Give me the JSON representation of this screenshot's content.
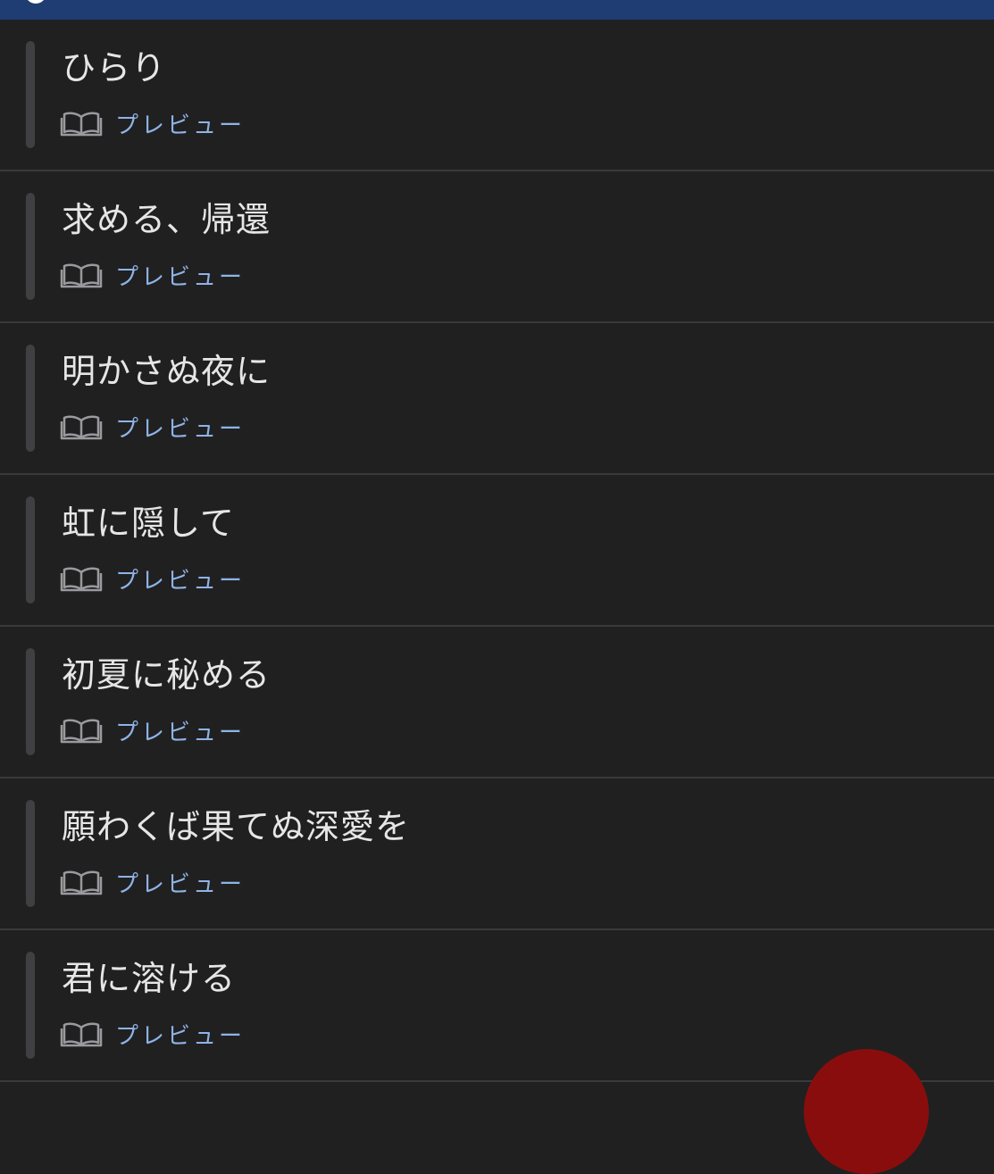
{
  "colors": {
    "background": "#202021",
    "top_bar": "#1f3d73",
    "title_text": "#e6e6e6",
    "preview_text": "#8fb3e6",
    "accent_bar": "#404043",
    "fab": "#8a0d0d"
  },
  "top_bar": {
    "icon": "search-icon"
  },
  "items": [
    {
      "title": "ひらり",
      "preview_label": "プレビュー",
      "icon": "book-icon"
    },
    {
      "title": "求める、帰還",
      "preview_label": "プレビュー",
      "icon": "book-icon"
    },
    {
      "title": "明かさぬ夜に",
      "preview_label": "プレビュー",
      "icon": "book-icon"
    },
    {
      "title": "虹に隠して",
      "preview_label": "プレビュー",
      "icon": "book-icon"
    },
    {
      "title": "初夏に秘める",
      "preview_label": "プレビュー",
      "icon": "book-icon"
    },
    {
      "title": "願わくば果てぬ深愛を",
      "preview_label": "プレビュー",
      "icon": "book-icon"
    },
    {
      "title": "君に溶ける",
      "preview_label": "プレビュー",
      "icon": "book-icon"
    }
  ]
}
